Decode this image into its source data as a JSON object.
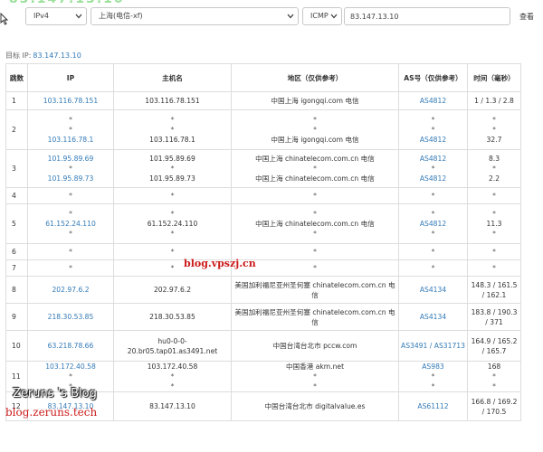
{
  "header": {
    "ip_version": "IPv4",
    "location": "上海(电信-xf)",
    "protocol": "ICMP",
    "target_value": "83.147.13.10",
    "query_label": "查看"
  },
  "target": {
    "label": "目标 IP:",
    "ip": "83.147.13.10"
  },
  "table": {
    "headers": {
      "hop": "跳数",
      "ip": "IP",
      "host": "主机名",
      "region": "地区（仅供参考）",
      "asn": "AS号（仅供参考）",
      "time": "时间（毫秒）"
    },
    "rows": [
      {
        "hop": "1",
        "ip": [
          "103.116.78.151"
        ],
        "host": [
          "103.116.78.151"
        ],
        "region": [
          "中国上海 igongqi.com 电信"
        ],
        "asn": [
          "AS4812"
        ],
        "time": [
          "1 / 1.3 / 2.8"
        ]
      },
      {
        "hop": "2",
        "ip": [
          "*",
          "*",
          "103.116.78.1"
        ],
        "host": [
          "*",
          "*",
          "103.116.78.1"
        ],
        "region": [
          "*",
          "*",
          "中国上海 igongqi.com 电信"
        ],
        "asn": [
          "*",
          "*",
          "AS4812"
        ],
        "time": [
          "*",
          "*",
          "32.7"
        ]
      },
      {
        "hop": "3",
        "ip": [
          "101.95.89.69",
          "*",
          "101.95.89.73"
        ],
        "host": [
          "101.95.89.69",
          "*",
          "101.95.89.73"
        ],
        "region": [
          "中国上海 chinatelecom.com.cn 电信",
          "*",
          "中国上海 chinatelecom.com.cn 电信"
        ],
        "asn": [
          "AS4812",
          "*",
          "AS4812"
        ],
        "time": [
          "8.3",
          "*",
          "2.2"
        ]
      },
      {
        "hop": "4",
        "ip": [
          "*"
        ],
        "host": [
          "*"
        ],
        "region": [
          "*"
        ],
        "asn": [
          "*"
        ],
        "time": [
          "*"
        ]
      },
      {
        "hop": "5",
        "ip": [
          "*",
          "61.152.24.110",
          "*"
        ],
        "host": [
          "*",
          "61.152.24.110",
          "*"
        ],
        "region": [
          "*",
          "中国上海 chinatelecom.com.cn 电信",
          "*"
        ],
        "asn": [
          "*",
          "AS4812",
          "*"
        ],
        "time": [
          "*",
          "11.3",
          "*"
        ]
      },
      {
        "hop": "6",
        "ip": [
          "*"
        ],
        "host": [
          "*"
        ],
        "region": [
          "*"
        ],
        "asn": [
          "*"
        ],
        "time": [
          "*"
        ]
      },
      {
        "hop": "7",
        "ip": [
          "*"
        ],
        "host": [
          "*"
        ],
        "region": [
          "*"
        ],
        "asn": [
          "*"
        ],
        "time": [
          "*"
        ]
      },
      {
        "hop": "8",
        "ip": [
          "202.97.6.2"
        ],
        "host": [
          "202.97.6.2"
        ],
        "region": [
          "美国加利福尼亚州圣何塞 chinatelecom.com.cn 电信"
        ],
        "asn": [
          "AS4134"
        ],
        "time": [
          "148.3 / 161.5 / 162.1"
        ]
      },
      {
        "hop": "9",
        "ip": [
          "218.30.53.85"
        ],
        "host": [
          "218.30.53.85"
        ],
        "region": [
          "美国加利福尼亚州圣何塞 chinatelecom.com.cn 电信"
        ],
        "asn": [
          "AS4134"
        ],
        "time": [
          "183.8 / 190.3 / 371"
        ]
      },
      {
        "hop": "10",
        "ip": [
          "63.218.78.66"
        ],
        "host": [
          "hu0-0-0-20.br05.tap01.as3491.net"
        ],
        "region": [
          "中国台湾台北市 pccw.com"
        ],
        "asn": [
          "AS3491 / AS31713"
        ],
        "time": [
          "164.9 / 165.2 / 165.7"
        ]
      },
      {
        "hop": "11",
        "ip": [
          "103.172.40.58",
          "*",
          "*"
        ],
        "host": [
          "103.172.40.58",
          "*",
          "*"
        ],
        "region": [
          "中国香港 akm.net",
          "*",
          "*"
        ],
        "asn": [
          "AS983",
          "*",
          "*"
        ],
        "time": [
          "168",
          "*",
          "*"
        ]
      },
      {
        "hop": "12",
        "ip": [
          "83.147.13.10"
        ],
        "host": [
          "83.147.13.10"
        ],
        "region": [
          "中国台湾台北市 digitalvalue.es"
        ],
        "asn": [
          "AS61112"
        ],
        "time": [
          "166.8 / 169.2 / 170.5"
        ]
      }
    ]
  },
  "watermarks": {
    "vps": "blog.vpszj.cn",
    "blog_title": "Zeruns 's Blog",
    "blog_url": "blog.zeruns.tech"
  },
  "colors": {
    "link": "#337ab7",
    "border": "#dddddd",
    "watermark_red": "#cc1b1b"
  },
  "icons": [
    "mouse-cursor-icon",
    "chevron-down-icon"
  ]
}
